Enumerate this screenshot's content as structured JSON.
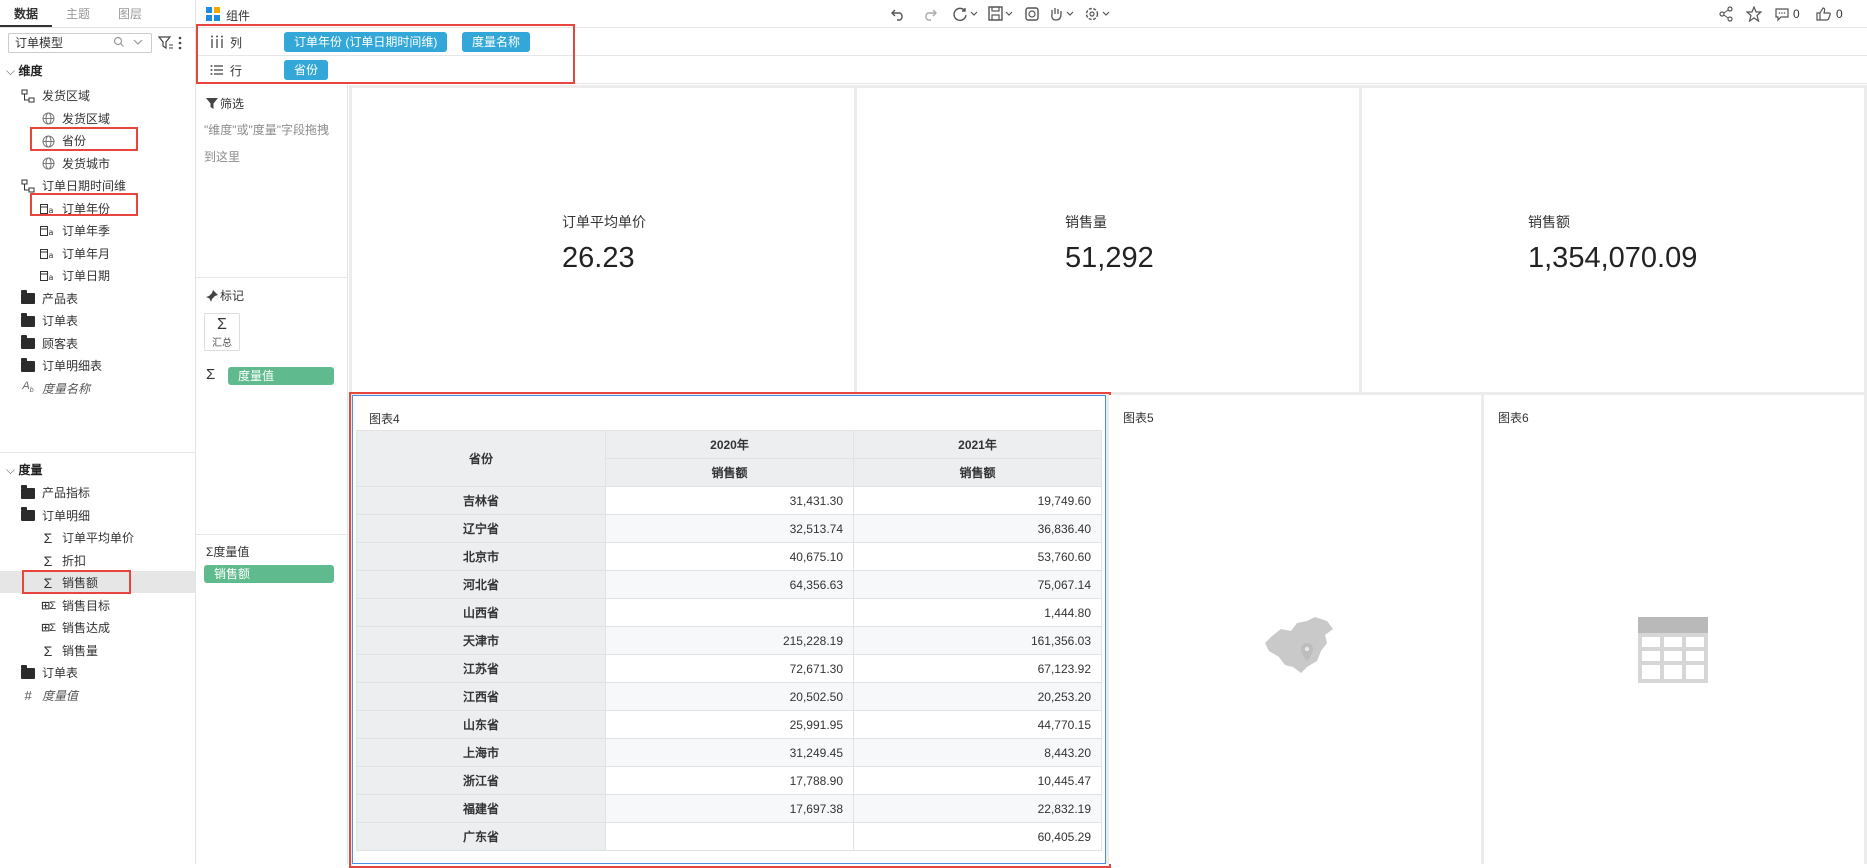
{
  "left_panel": {
    "tabs": [
      "数据",
      "主题",
      "图层"
    ],
    "model_select": "订单模型",
    "dimension_header": "维度",
    "dimension_tree": [
      {
        "label": "发货区域",
        "kind": "hierarchy",
        "level": 1
      },
      {
        "label": "发货区域",
        "kind": "geo",
        "level": 2
      },
      {
        "label": "省份",
        "kind": "geo",
        "level": 2
      },
      {
        "label": "发货城市",
        "kind": "geo",
        "level": 2
      },
      {
        "label": "订单日期时间维",
        "kind": "hierarchy",
        "level": 1
      },
      {
        "label": "订单年份",
        "kind": "date",
        "level": 2
      },
      {
        "label": "订单年季",
        "kind": "date",
        "level": 2
      },
      {
        "label": "订单年月",
        "kind": "date",
        "level": 2
      },
      {
        "label": "订单日期",
        "kind": "date",
        "level": 2
      },
      {
        "label": "产品表",
        "kind": "folder",
        "level": 1
      },
      {
        "label": "订单表",
        "kind": "folder",
        "level": 1
      },
      {
        "label": "顾客表",
        "kind": "folder",
        "level": 1
      },
      {
        "label": "订单明细表",
        "kind": "folder",
        "level": 1
      },
      {
        "label": "度量名称",
        "kind": "text-italic",
        "level": 1
      }
    ],
    "measure_header": "度量",
    "measure_tree": [
      {
        "label": "产品指标",
        "kind": "folder",
        "level": 1
      },
      {
        "label": "订单明细",
        "kind": "folder-open",
        "level": 1
      },
      {
        "label": "订单平均单价",
        "kind": "sigma",
        "level": 2
      },
      {
        "label": "折扣",
        "kind": "sigma",
        "level": 2
      },
      {
        "label": "销售额",
        "kind": "sigma",
        "level": 2
      },
      {
        "label": "销售目标",
        "kind": "sigma-calc",
        "level": 2
      },
      {
        "label": "销售达成",
        "kind": "sigma-calc",
        "level": 2
      },
      {
        "label": "销售量",
        "kind": "sigma",
        "level": 2
      },
      {
        "label": "订单表",
        "kind": "folder",
        "level": 1
      },
      {
        "label": "度量值",
        "kind": "hash-italic",
        "level": 1
      }
    ]
  },
  "toolbar": {
    "component_label": "组件",
    "comment_count": "0",
    "like_count": "0"
  },
  "shelves": {
    "columns_label": "列",
    "rows_label": "行",
    "column_pills": [
      "订单年份 (订单日期时间维)",
      "度量名称"
    ],
    "row_pills": [
      "省份"
    ]
  },
  "mid_panel": {
    "filter_title": "筛选",
    "filter_hint": "\"维度\"或\"度量\"字段拖拽到这里",
    "marks_title": "标记",
    "summary_label": "汇总",
    "measure_pill": "度量值",
    "measure_values_title": "度量值",
    "measure_values_pill": "销售额"
  },
  "kpis": [
    {
      "label": "订单平均单价",
      "value": "26.23"
    },
    {
      "label": "销售量",
      "value": "51,292"
    },
    {
      "label": "销售额",
      "value": "1,354,070.09"
    }
  ],
  "chart4": {
    "title": "图表4",
    "row_header": "省份",
    "years": [
      "2020年",
      "2021年"
    ],
    "measure_name": "销售额",
    "rows": [
      {
        "province": "吉林省",
        "y2020": "31,431.30",
        "y2021": "19,749.60"
      },
      {
        "province": "辽宁省",
        "y2020": "32,513.74",
        "y2021": "36,836.40"
      },
      {
        "province": "北京市",
        "y2020": "40,675.10",
        "y2021": "53,760.60"
      },
      {
        "province": "河北省",
        "y2020": "64,356.63",
        "y2021": "75,067.14"
      },
      {
        "province": "山西省",
        "y2020": "",
        "y2021": "1,444.80"
      },
      {
        "province": "天津市",
        "y2020": "215,228.19",
        "y2021": "161,356.03"
      },
      {
        "province": "江苏省",
        "y2020": "72,671.30",
        "y2021": "67,123.92"
      },
      {
        "province": "江西省",
        "y2020": "20,502.50",
        "y2021": "20,253.20"
      },
      {
        "province": "山东省",
        "y2020": "25,991.95",
        "y2021": "44,770.15"
      },
      {
        "province": "上海市",
        "y2020": "31,249.45",
        "y2021": "8,443.20"
      },
      {
        "province": "浙江省",
        "y2020": "17,788.90",
        "y2021": "10,445.47"
      },
      {
        "province": "福建省",
        "y2020": "17,697.38",
        "y2021": "22,832.19"
      },
      {
        "province": "广东省",
        "y2020": "",
        "y2021": "60,405.29"
      }
    ]
  },
  "chart5": {
    "title": "图表5",
    "placeholder_icon": "china-map-icon"
  },
  "chart6": {
    "title": "图表6",
    "placeholder_icon": "table-icon"
  },
  "colors": {
    "pill_blue": "#33a8d8",
    "pill_green": "#5fbb8e",
    "highlight_red": "#e8453c"
  }
}
